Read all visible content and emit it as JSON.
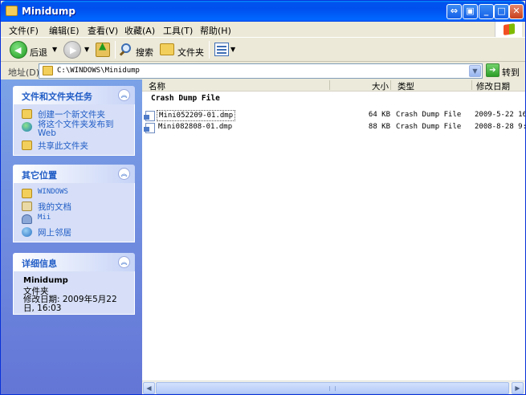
{
  "window": {
    "title": "Minidump"
  },
  "menu": [
    "文件(F)",
    "编辑(E)",
    "查看(V)",
    "收藏(A)",
    "工具(T)",
    "帮助(H)"
  ],
  "toolbar": {
    "back_label": "后退",
    "search_label": "搜索",
    "folders_label": "文件夹"
  },
  "address": {
    "label": "地址(D)",
    "value": "C:\\WINDOWS\\Minidump",
    "go_label": "转到"
  },
  "tasks_panel": {
    "title": "文件和文件夹任务",
    "items": [
      "创建一个新文件夹",
      "将这个文件夹发布到 Web",
      "共享此文件夹"
    ]
  },
  "other_places": {
    "title": "其它位置",
    "items": [
      "WINDOWS",
      "我的文档",
      "Mii",
      "网上邻居"
    ]
  },
  "details": {
    "title": "详细信息",
    "name": "Minidump",
    "type": "文件夹",
    "modified": "修改日期: 2009年5月22日, 16:03"
  },
  "filelist": {
    "columns": {
      "name": "名称",
      "size": "大小",
      "type": "类型",
      "modified": "修改日期"
    },
    "group": "Crash Dump File",
    "files": [
      {
        "name": "Mini052209-01.dmp",
        "size": "64 KB",
        "type": "Crash Dump File",
        "modified": "2009-5-22 16"
      },
      {
        "name": "Mini082808-01.dmp",
        "size": "88 KB",
        "type": "Crash Dump File",
        "modified": "2008-8-28 9:"
      }
    ]
  },
  "colors": {
    "titlebar": "#0058EE",
    "taskpane": "#6F8EDC",
    "link": "#215DC6"
  },
  "icons": [
    "folder-icon",
    "back-arrow-icon",
    "forward-arrow-icon",
    "up-folder-icon",
    "search-icon",
    "folders-icon",
    "views-icon",
    "go-arrow-icon",
    "dump-file-icon"
  ]
}
